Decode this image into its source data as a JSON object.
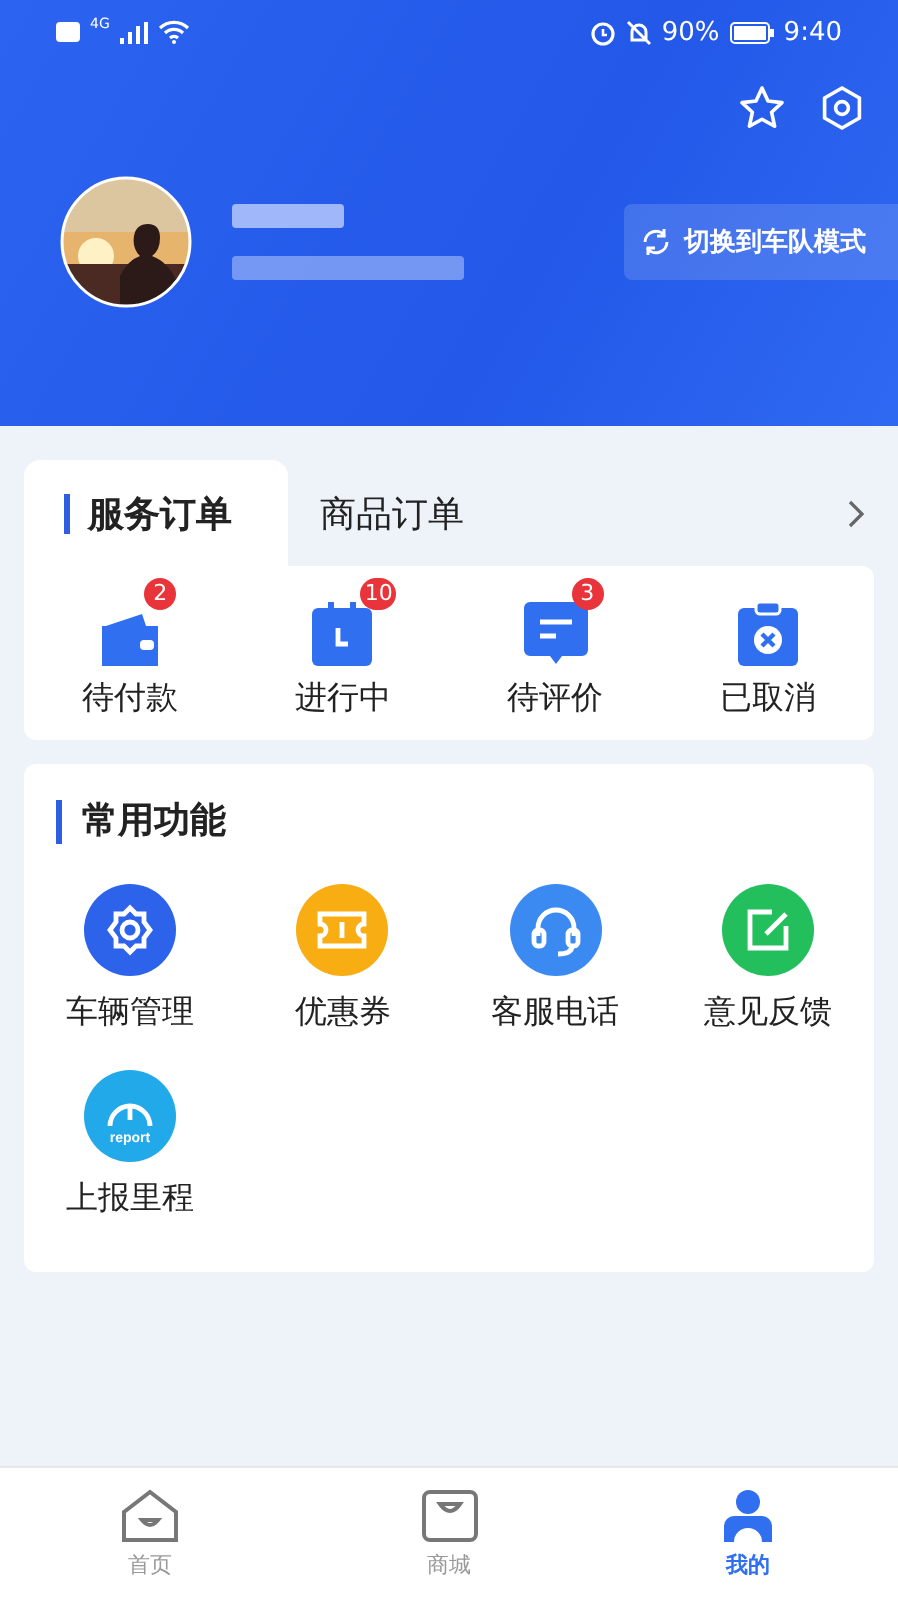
{
  "status_bar": {
    "network": "4G",
    "battery": "90%",
    "time": "9:40"
  },
  "profile": {
    "switch_button": "切换到车队模式"
  },
  "order_tabs": [
    {
      "label": "服务订单",
      "selected": true
    },
    {
      "label": "商品订单",
      "selected": false
    }
  ],
  "orders": [
    {
      "kind": "wallet",
      "label": "待付款",
      "badge": "2"
    },
    {
      "kind": "calendar",
      "label": "进行中",
      "badge": "10"
    },
    {
      "kind": "message",
      "label": "待评价",
      "badge": "3"
    },
    {
      "kind": "cancel",
      "label": "已取消"
    }
  ],
  "functions": {
    "title": "常用功能",
    "items": [
      {
        "kind": "gear",
        "label": "车辆管理"
      },
      {
        "kind": "ticket",
        "label": "优惠券"
      },
      {
        "kind": "headset",
        "label": "客服电话"
      },
      {
        "kind": "edit",
        "label": "意见反馈"
      },
      {
        "kind": "report",
        "label": "上报里程",
        "icon_text": "report"
      }
    ]
  },
  "nav": [
    {
      "kind": "home",
      "label": "首页",
      "selected": false
    },
    {
      "kind": "shop",
      "label": "商城",
      "selected": false
    },
    {
      "kind": "user",
      "label": "我的",
      "selected": true
    }
  ]
}
